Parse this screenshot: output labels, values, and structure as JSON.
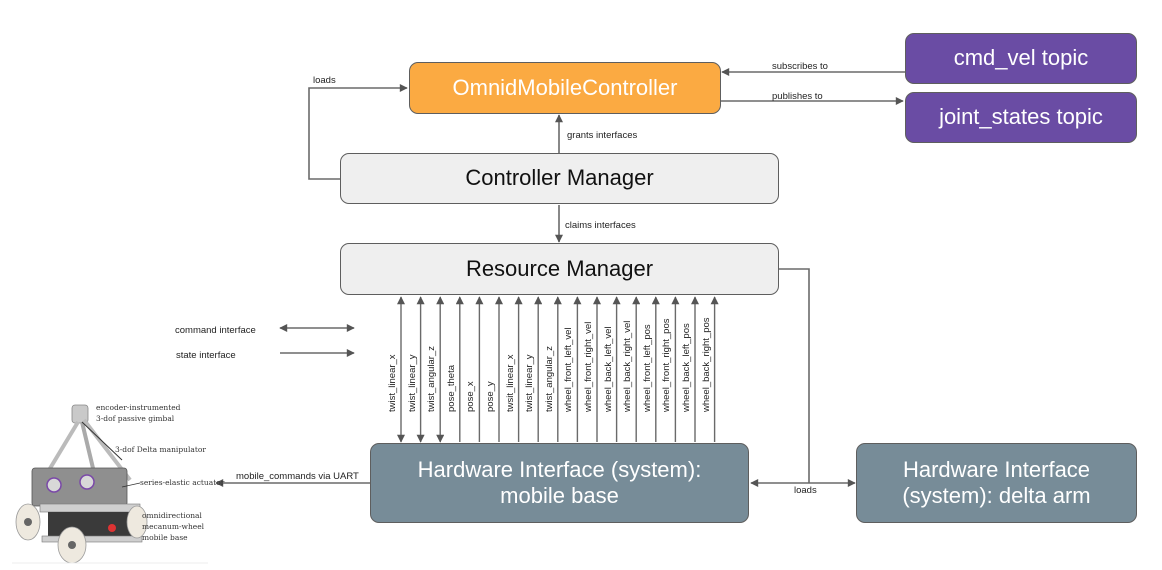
{
  "nodes": {
    "controller": "OmnidMobileController",
    "cmd_vel": "cmd_vel topic",
    "joint_states": "joint_states topic",
    "controller_manager": "Controller Manager",
    "resource_manager": "Resource Manager",
    "hw_mobile_line1": "Hardware Interface (system):",
    "hw_mobile_line2": "mobile base",
    "hw_delta_line1": "Hardware Interface",
    "hw_delta_line2": "(system): delta arm"
  },
  "edges": {
    "loads_controller": "loads",
    "subscribes": "subscribes to",
    "publishes": "publishes to",
    "grants": "grants interfaces",
    "claims": "claims interfaces",
    "loads_hw": "loads",
    "uart": "mobile_commands via UART"
  },
  "legend": {
    "command": "command interface",
    "state": "state interface"
  },
  "interfaces": [
    {
      "name": "twist_linear_x",
      "type": "command"
    },
    {
      "name": "twist_linear_y",
      "type": "command"
    },
    {
      "name": "twist_angular_z",
      "type": "command"
    },
    {
      "name": "pose_theta",
      "type": "state"
    },
    {
      "name": "pose_x",
      "type": "state"
    },
    {
      "name": "pose_y",
      "type": "state"
    },
    {
      "name": "twsit_linear_x",
      "type": "state"
    },
    {
      "name": "twist_linear_y",
      "type": "state"
    },
    {
      "name": "twist_angular_z",
      "type": "state"
    },
    {
      "name": "wheel_front_left_vel",
      "type": "state"
    },
    {
      "name": "wheel_front_right_vel",
      "type": "state"
    },
    {
      "name": "wheel_back_left_vel",
      "type": "state"
    },
    {
      "name": "wheel_back_right_vel",
      "type": "state"
    },
    {
      "name": "wheel_front_left_pos",
      "type": "state"
    },
    {
      "name": "wheel_front_right_pos",
      "type": "state"
    },
    {
      "name": "wheel_back_left_pos",
      "type": "state"
    },
    {
      "name": "wheel_back_right_pos",
      "type": "state"
    }
  ],
  "robot_photo": {
    "captions": [
      "encoder-instrumented",
      "3-dof passive gimbal",
      "3-dof Delta manipulator",
      "series-elastic actuator",
      "omnidirectional",
      "mecanum-wheel",
      "mobile base"
    ]
  },
  "colors": {
    "controller": "#fbaa42",
    "topic": "#6a4ca4",
    "manager": "#efefef",
    "hardware": "#778c98",
    "line": "#5e5e5e"
  }
}
